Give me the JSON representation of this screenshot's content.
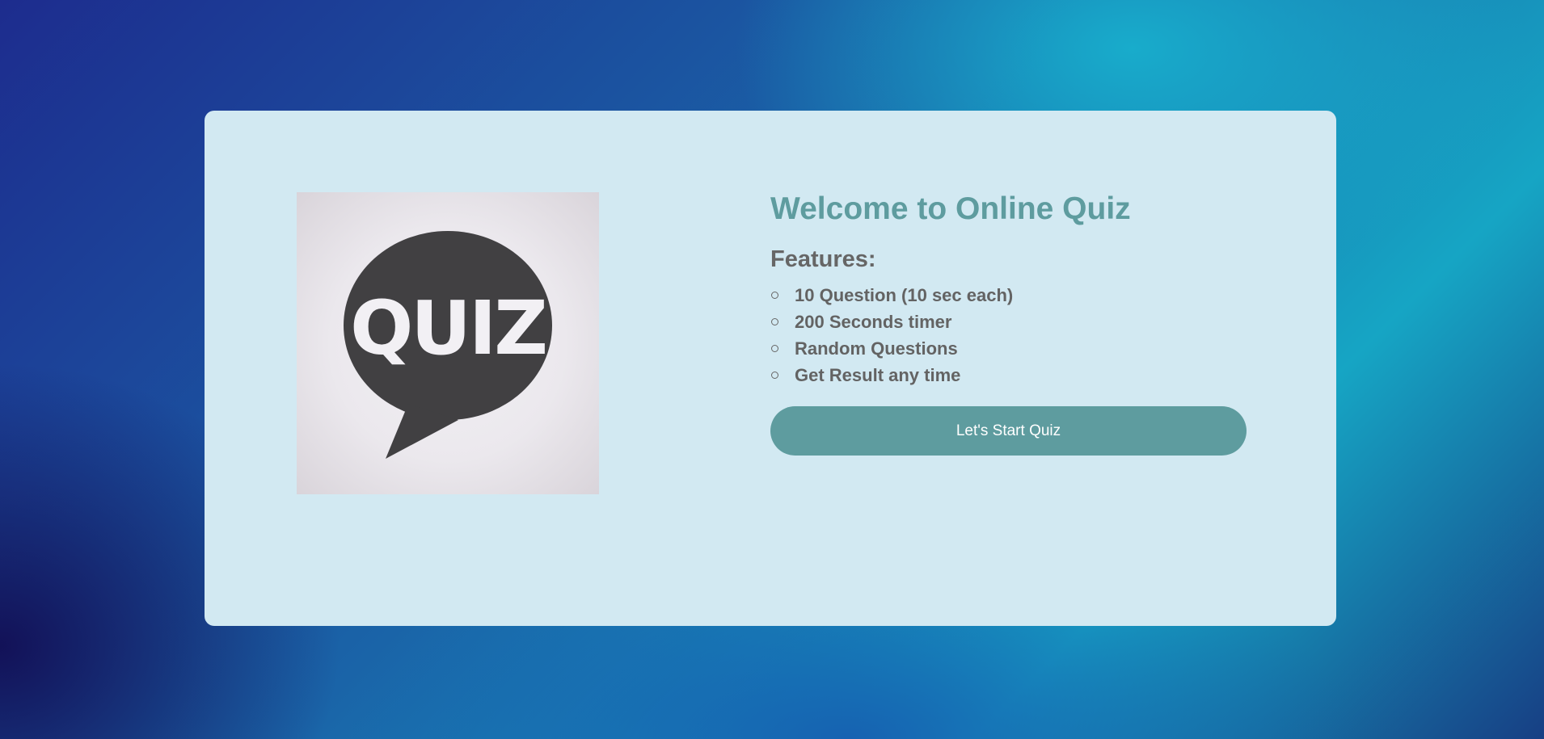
{
  "logo": {
    "text": "QUIZ",
    "icon": "speech-bubble-icon"
  },
  "main": {
    "title": "Welcome to Online Quiz",
    "features_heading": "Features:",
    "features": [
      "10 Question (10 sec each)",
      "200 Seconds timer",
      "Random Questions",
      "Get Result any time"
    ],
    "start_button_label": "Let's Start Quiz"
  },
  "colors": {
    "accent": "#5e9c9f",
    "card_background": "#d2e9f2",
    "text": "#666666",
    "logo_bubble": "#414042"
  }
}
